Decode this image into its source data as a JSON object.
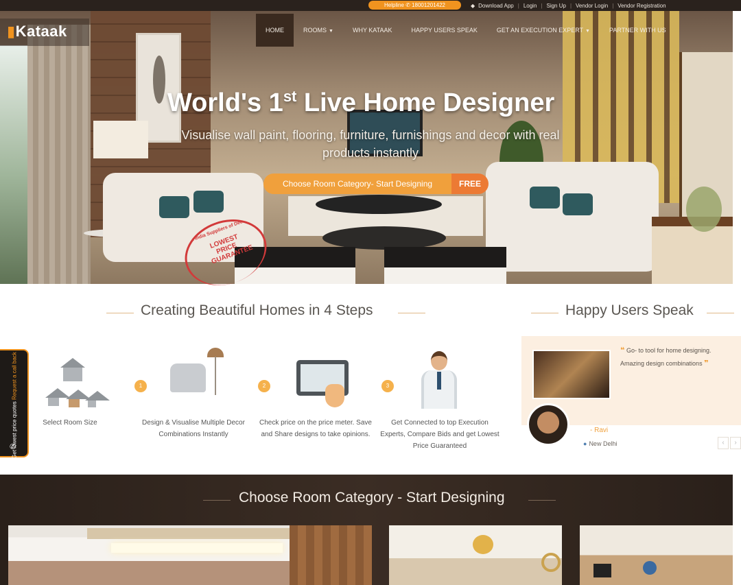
{
  "topbar": {
    "helpline": "Helpline ✆ 18001201422",
    "links": [
      "Download App",
      "Login",
      "Sign Up",
      "Vendor Login",
      "Vendor Registration"
    ]
  },
  "nav": {
    "logo": "Kataak",
    "items": [
      {
        "label": "Home",
        "active": true
      },
      {
        "label": "Rooms",
        "dropdown": true
      },
      {
        "label": "Why Kataak"
      },
      {
        "label": "Happy Users Speak"
      },
      {
        "label": "Get an Execution Expert",
        "dropdown": true
      },
      {
        "label": "Partner with us"
      }
    ]
  },
  "hero": {
    "title_pre": "World's 1",
    "title_sup": "st",
    "title_post": " Live Home Designer",
    "subtitle": "Visualise wall paint, flooring, furniture, furnishings and decor with real products instantly",
    "cta_label": "Choose Room Category- Start Designing",
    "cta_free": "FREE",
    "stamp_outer": "Pan India Suppliers of Decor",
    "stamp_text": "LOWEST PRICE GUARANTEE"
  },
  "side_tab": {
    "text_main": "Get lowest price quotes",
    "text_accent": "Request a call back"
  },
  "steps": {
    "title": "Creating Beautiful Homes in 4 Steps",
    "items": [
      {
        "label": "Select Room Size",
        "icon": "house-icon"
      },
      {
        "label": "Design & Visualise Multiple Decor Combinations Instantly",
        "icon": "furniture-icon"
      },
      {
        "label": "Check price on the price meter. Save and Share designs to take opinions.",
        "icon": "tablet-icon"
      },
      {
        "label": "Get Connected to top Execution Experts, Compare Bids and get Lowest Price Guaranteed",
        "icon": "expert-icon"
      }
    ],
    "dots": [
      "1",
      "2",
      "3"
    ]
  },
  "testimonials": {
    "title": "Happy Users Speak",
    "quote": "Go- to tool for home designing. Amazing design combinations",
    "name": "- Ravi",
    "location": "New Delhi"
  },
  "rooms": {
    "title": "Choose Room Category - Start Designing"
  },
  "colors": {
    "accent": "#f0931f",
    "dark": "#2a221d"
  }
}
